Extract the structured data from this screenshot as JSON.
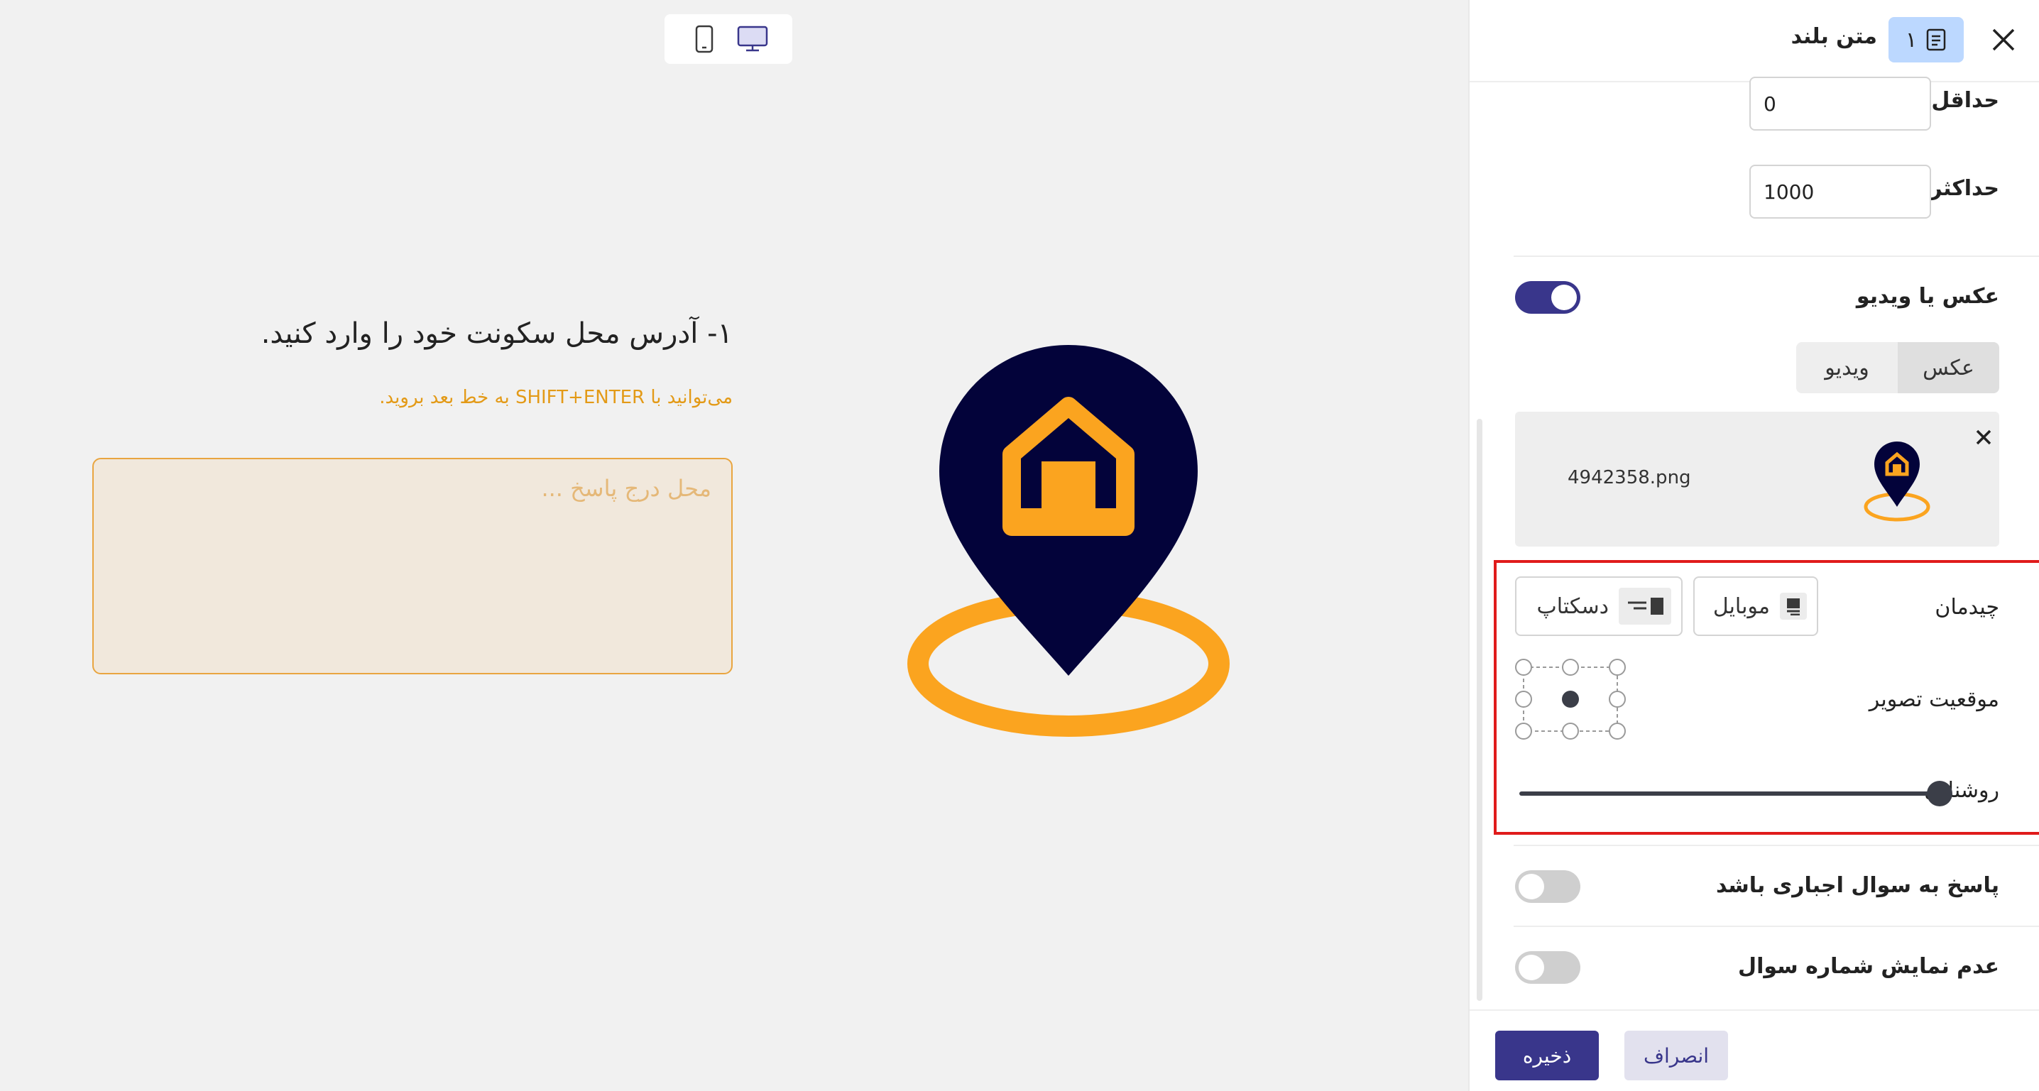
{
  "stage": {
    "device_switch": {
      "mobile_icon": "mobile-icon",
      "desktop_icon": "desktop-icon",
      "selected": "desktop"
    },
    "question": {
      "title": "۱- آدرس محل سکونت خود را وارد کنید.",
      "hint": "می‌توانید با SHIFT+ENTER به خط بعد بروید.",
      "answer_placeholder": "محل درج پاسخ ..."
    },
    "hero_image": {
      "icon": "location-pin-home-icon",
      "colors": {
        "pin": "#03033a",
        "accent": "#fba41f"
      }
    }
  },
  "panel": {
    "header": {
      "title": "متن بلند",
      "badge_number": "۱",
      "badge_icon": "document-icon",
      "close_icon": "close-icon"
    },
    "min": {
      "label": "حداقل",
      "value": "0"
    },
    "max": {
      "label": "حداکثر",
      "value": "1000"
    },
    "media": {
      "label": "عکس یا ویدیو",
      "enabled": true,
      "tabs": {
        "photo": "عکس",
        "video": "ویدیو",
        "selected": "photo"
      },
      "file": {
        "name": "4942358.png",
        "remove_icon": "close-icon"
      }
    },
    "layout": {
      "label": "چیدمان",
      "mobile_label": "موبایل",
      "desktop_label": "دسکتاپ",
      "mobile_icon": "mobile-layout-icon",
      "desktop_icon": "desktop-layout-icon"
    },
    "image_position": {
      "label": "موقعیت تصویر",
      "selected": "center"
    },
    "brightness": {
      "label": "روشنایی",
      "value": 1.0
    },
    "required": {
      "label": "پاسخ به سوال اجباری باشد",
      "enabled": false
    },
    "hide_number": {
      "label": "عدم نمایش شماره سوال",
      "enabled": false
    },
    "footer": {
      "save": "ذخیره",
      "cancel": "انصراف"
    }
  },
  "colors": {
    "primary": "#39368b",
    "highlight_border": "#e01b1b",
    "hint": "#e39a17"
  }
}
